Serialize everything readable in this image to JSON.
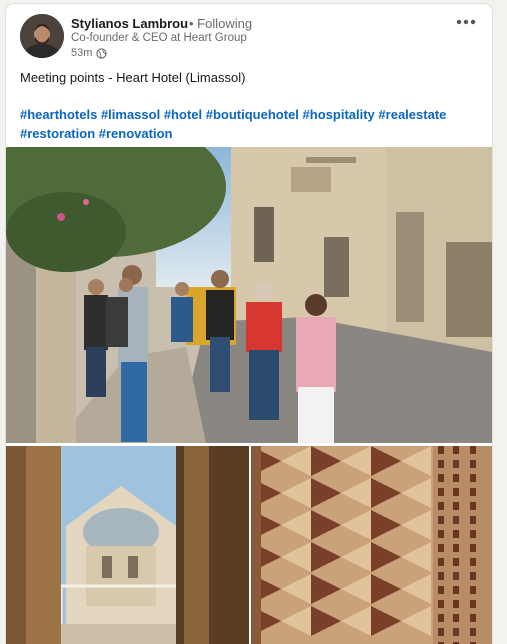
{
  "post": {
    "author": {
      "name": "Stylianos Lambrou",
      "follow_status": "• Following",
      "headline": "Co-founder & CEO at Heart Group",
      "time": "53m",
      "visibility_icon": "globe-icon"
    },
    "more_icon": "more-options-icon",
    "text": "Meeting points - Heart Hotel (Limassol)",
    "hashtags": [
      "#hearthotels",
      "#limassol",
      "#hotel",
      "#boutiquehotel",
      "#hospitality",
      "#realestate",
      "#restoration",
      "#renovation"
    ],
    "images": [
      {
        "name": "street-group-photo"
      },
      {
        "name": "window-view-photo"
      },
      {
        "name": "mosaic-floor-photo"
      }
    ]
  },
  "colors": {
    "link": "#0a66c2",
    "background": "#f3f2ef",
    "card": "#ffffff"
  }
}
